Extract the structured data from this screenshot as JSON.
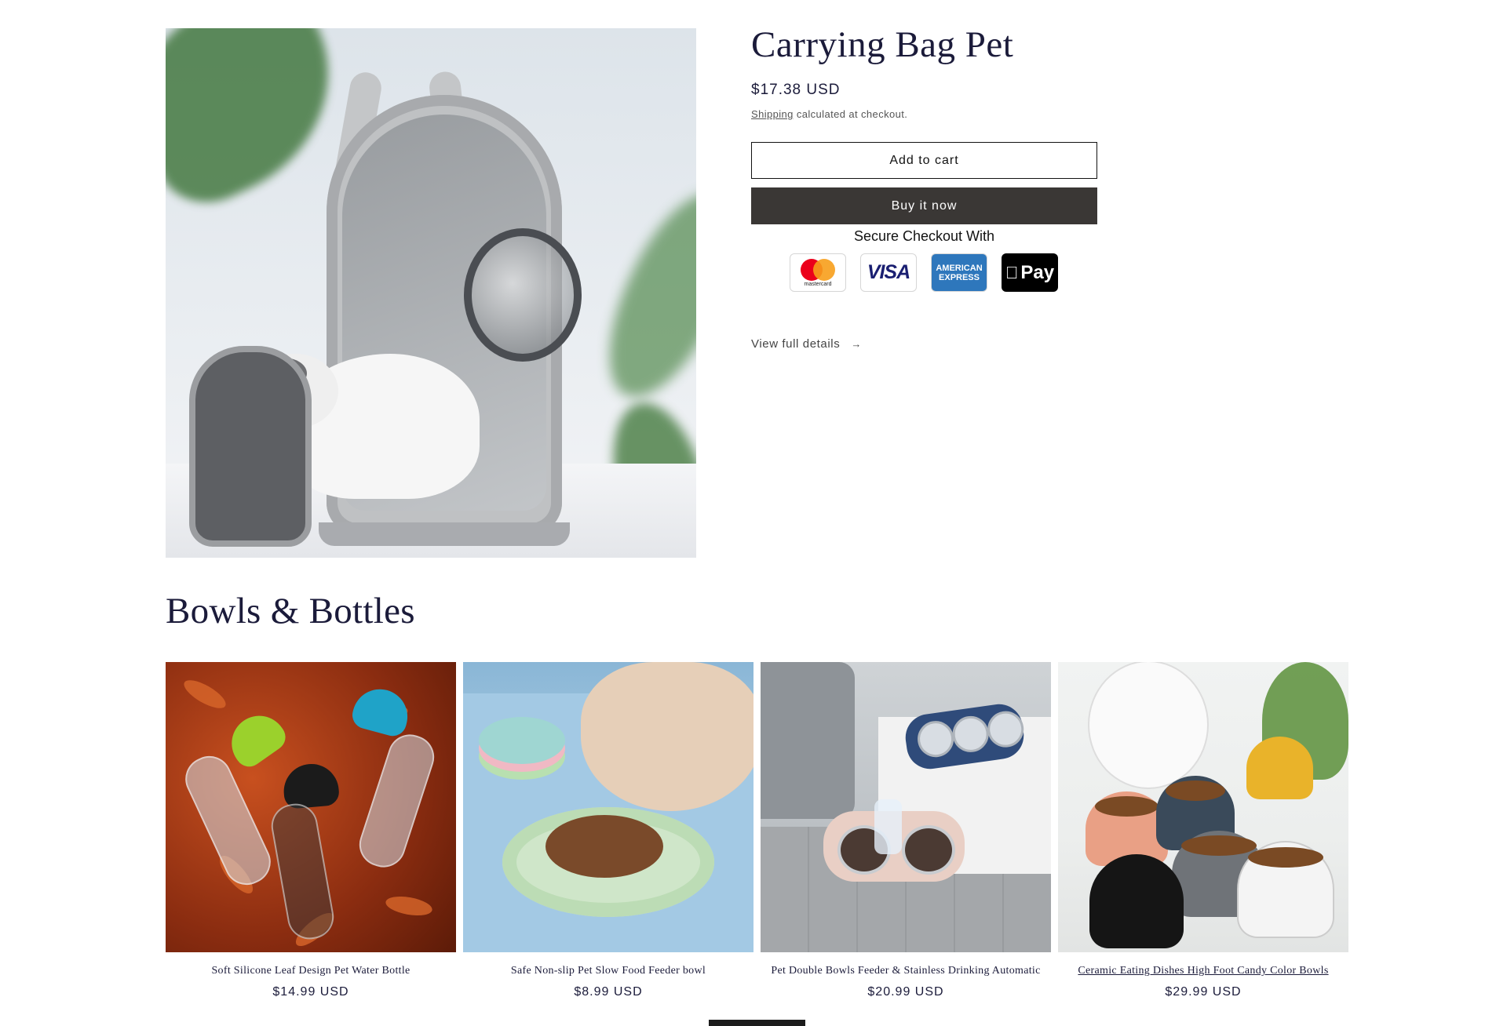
{
  "product": {
    "title": "Carrying Bag Pet",
    "price": "$17.38 USD",
    "shipping_link": "Shipping",
    "shipping_rest": " calculated at checkout.",
    "add_to_cart": "Add to cart",
    "buy_now": "Buy it now",
    "secure_checkout": "Secure Checkout With",
    "payment_icons": [
      {
        "name": "mastercard-icon",
        "text": "mastercard"
      },
      {
        "name": "visa-icon",
        "text": "VISA"
      },
      {
        "name": "amex-icon",
        "text_1": "AMERICAN",
        "text_2": "EXPRESS"
      },
      {
        "name": "apple-pay-icon",
        "text": "Pay"
      }
    ],
    "view_details": "View full details",
    "image_icon": "pet-carrier-backpack-image"
  },
  "collection": {
    "title": "Bowls & Bottles",
    "items": [
      {
        "title": "Soft Silicone Leaf Design Pet Water Bottle",
        "price": "$14.99 USD"
      },
      {
        "title": "Safe Non-slip Pet Slow Food Feeder bowl",
        "price": "$8.99 USD"
      },
      {
        "title": "Pet Double Bowls Feeder & Stainless Drinking Automatic",
        "price": "$20.99 USD"
      },
      {
        "title": "Ceramic Eating Dishes High Foot Candy Color Bowls",
        "price": "$29.99 USD"
      }
    ]
  },
  "colors": {
    "heading": "#1b1b3a",
    "buy_button": "#3a3735",
    "mastercard_red": "#eb001b",
    "mastercard_yellow": "#f79e1b",
    "visa_blue": "#1a1f71",
    "amex_blue": "#2e77bc"
  }
}
